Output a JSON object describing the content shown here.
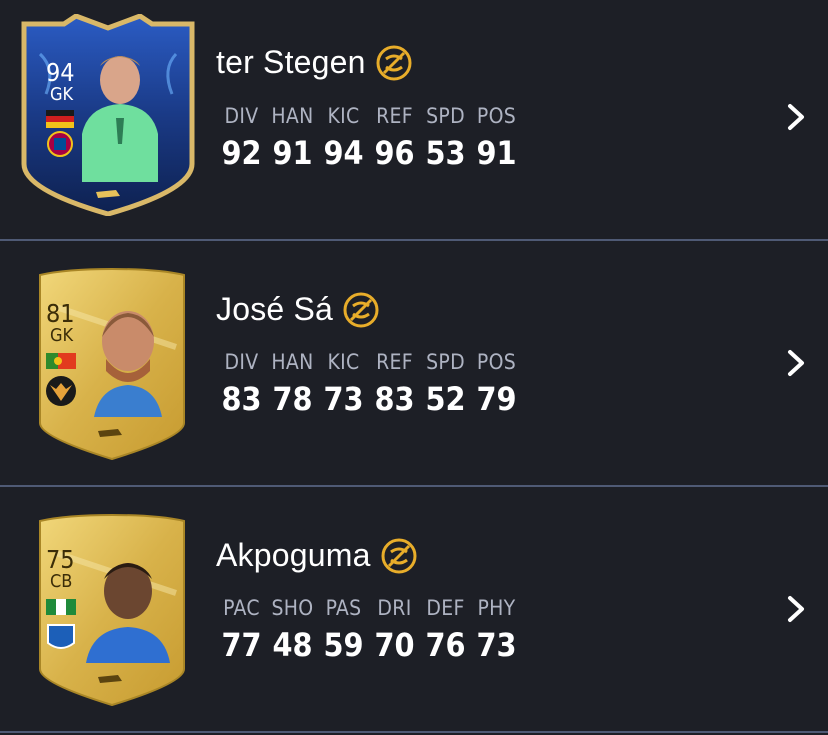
{
  "players": [
    {
      "card_style": "tots",
      "rating": "94",
      "position": "GK",
      "name": "ter Stegen",
      "chemistry_icon": "loyalty-badge-icon",
      "stats": [
        {
          "label": "DIV",
          "value": "92"
        },
        {
          "label": "HAN",
          "value": "91"
        },
        {
          "label": "KIC",
          "value": "94"
        },
        {
          "label": "REF",
          "value": "96"
        },
        {
          "label": "SPD",
          "value": "53"
        },
        {
          "label": "POS",
          "value": "91"
        }
      ]
    },
    {
      "card_style": "gold",
      "rating": "81",
      "position": "GK",
      "name": "José Sá",
      "chemistry_icon": "loyalty-badge-icon",
      "stats": [
        {
          "label": "DIV",
          "value": "83"
        },
        {
          "label": "HAN",
          "value": "78"
        },
        {
          "label": "KIC",
          "value": "73"
        },
        {
          "label": "REF",
          "value": "83"
        },
        {
          "label": "SPD",
          "value": "52"
        },
        {
          "label": "POS",
          "value": "79"
        }
      ]
    },
    {
      "card_style": "gold",
      "rating": "75",
      "position": "CB",
      "name": "Akpoguma",
      "chemistry_icon": "loyalty-badge-icon",
      "stats": [
        {
          "label": "PAC",
          "value": "77"
        },
        {
          "label": "SHO",
          "value": "48"
        },
        {
          "label": "PAS",
          "value": "59"
        },
        {
          "label": "DRI",
          "value": "70"
        },
        {
          "label": "DEF",
          "value": "76"
        },
        {
          "label": "PHY",
          "value": "73"
        }
      ]
    }
  ],
  "colors": {
    "background": "#1d1f26",
    "divider": "#4f5a75",
    "label": "#aeb3c2",
    "badge": "#e8ad2a",
    "gold_card": "#d9b33f",
    "tots_card": "#1f3f8a"
  }
}
